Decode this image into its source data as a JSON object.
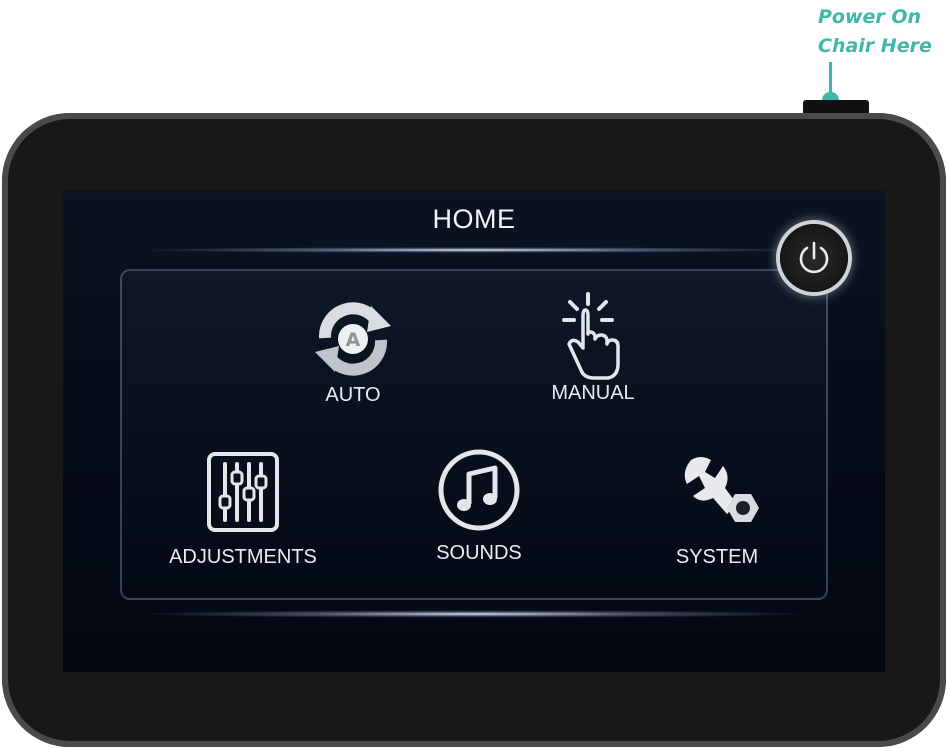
{
  "callout": {
    "line1": "Power On",
    "line2": "Chair Here"
  },
  "screen": {
    "title": "HOME",
    "power_button_icon": "power-icon",
    "tiles": [
      {
        "label": "AUTO",
        "icon": "auto-cycle-icon"
      },
      {
        "label": "MANUAL",
        "icon": "hand-tap-icon"
      },
      {
        "label": "ADJUSTMENTS",
        "icon": "sliders-icon"
      },
      {
        "label": "SOUNDS",
        "icon": "music-note-icon"
      },
      {
        "label": "SYSTEM",
        "icon": "wrench-icon"
      }
    ]
  },
  "colors": {
    "callout_accent": "#3fb7a9",
    "bezel": "#1a1717",
    "screen_bg": "#060c18",
    "label_text": "#e8ecf2"
  }
}
